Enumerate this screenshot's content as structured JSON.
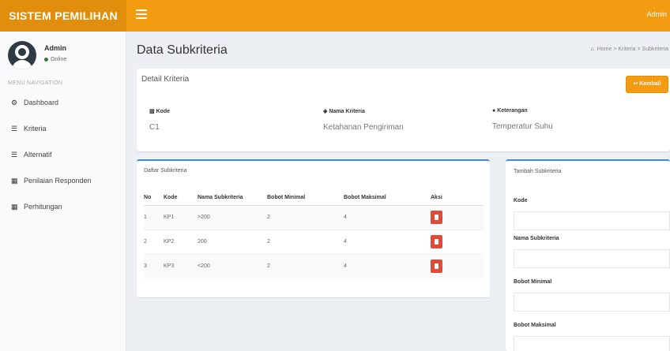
{
  "app": {
    "brand": "SISTEM PEMILIHAN",
    "top_user": "Admin"
  },
  "sidebar": {
    "user_name": "Admin",
    "user_status": "Online",
    "nav_header": "MENU NAVIGATION",
    "items": [
      {
        "label": "Dashboard",
        "icon": "dashboard-icon"
      },
      {
        "label": "Kriteria",
        "icon": "list-icon"
      },
      {
        "label": "Alternatif",
        "icon": "list-alt-icon"
      },
      {
        "label": "Penilaian Responden",
        "icon": "table-icon"
      },
      {
        "label": "Perhitungan",
        "icon": "calculator-icon"
      }
    ]
  },
  "page": {
    "title": "Data Subkriteria",
    "breadcrumb": [
      "Home",
      "Kriteria",
      "Subkriteria"
    ]
  },
  "detail": {
    "title": "Detail Kriteria",
    "back_button": "Kembali",
    "kode_label": "Kode",
    "kode_value": "C1",
    "nama_label": "Nama Kriteria",
    "nama_value": "Ketahanan Pengiriman",
    "keterangan_label": "Keterangan",
    "keterangan_value": "Temperatur Suhu"
  },
  "list": {
    "title": "Daftar Subkriteria",
    "columns": [
      "No",
      "Kode",
      "Nama Subkriteria",
      "Bobot Minimal",
      "Bobot Maksimal",
      "Aksi"
    ],
    "rows": [
      {
        "no": "1",
        "kode": "KP1",
        "nama": ">200",
        "min": "2",
        "maks": "4"
      },
      {
        "no": "2",
        "kode": "KP2",
        "nama": "200",
        "min": "2",
        "maks": "4"
      },
      {
        "no": "3",
        "kode": "KP3",
        "nama": "<200",
        "min": "2",
        "maks": "4"
      }
    ]
  },
  "form": {
    "title": "Tambah Subkriteria",
    "kode_label": "Kode",
    "nama_label": "Nama Subkriteria",
    "min_label": "Bobot Minimal",
    "maks_label": "Bobot Maksimal"
  },
  "colors": {
    "accent": "#f39c12",
    "accent_dark": "#e08e0b",
    "danger": "#dd4b39",
    "box_border": "#3c8dbc"
  }
}
